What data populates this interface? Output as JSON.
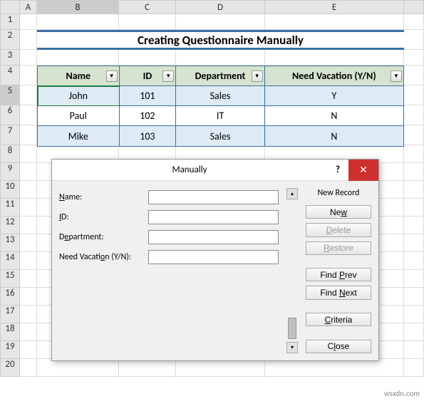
{
  "columns": [
    "A",
    "B",
    "C",
    "D",
    "E"
  ],
  "rows": [
    "1",
    "2",
    "3",
    "4",
    "5",
    "6",
    "7",
    "8",
    "9",
    "10",
    "11",
    "12",
    "13",
    "14",
    "15",
    "16",
    "17",
    "18",
    "19",
    "20"
  ],
  "title": "Creating Questionnaire Manually",
  "table": {
    "headers": [
      "Name",
      "ID",
      "Department",
      "Need Vacation (Y/N)"
    ],
    "rows": [
      [
        "John",
        "101",
        "Sales",
        "Y"
      ],
      [
        "Paul",
        "102",
        "IT",
        "N"
      ],
      [
        "Mike",
        "103",
        "Sales",
        "N"
      ]
    ]
  },
  "dialog": {
    "title": "Manually",
    "help": "?",
    "close": "✕",
    "fields": [
      {
        "label": "Name:"
      },
      {
        "label": "ID:"
      },
      {
        "label": "Department:"
      },
      {
        "label": "Need Vacation (Y/N):"
      }
    ],
    "status": "New Record",
    "buttons": {
      "new": "New",
      "delete": "Delete",
      "restore": "Restore",
      "findprev": "Find Prev",
      "findnext": "Find Next",
      "criteria": "Criteria",
      "close": "Close"
    }
  },
  "watermark": "wsxdn.com"
}
